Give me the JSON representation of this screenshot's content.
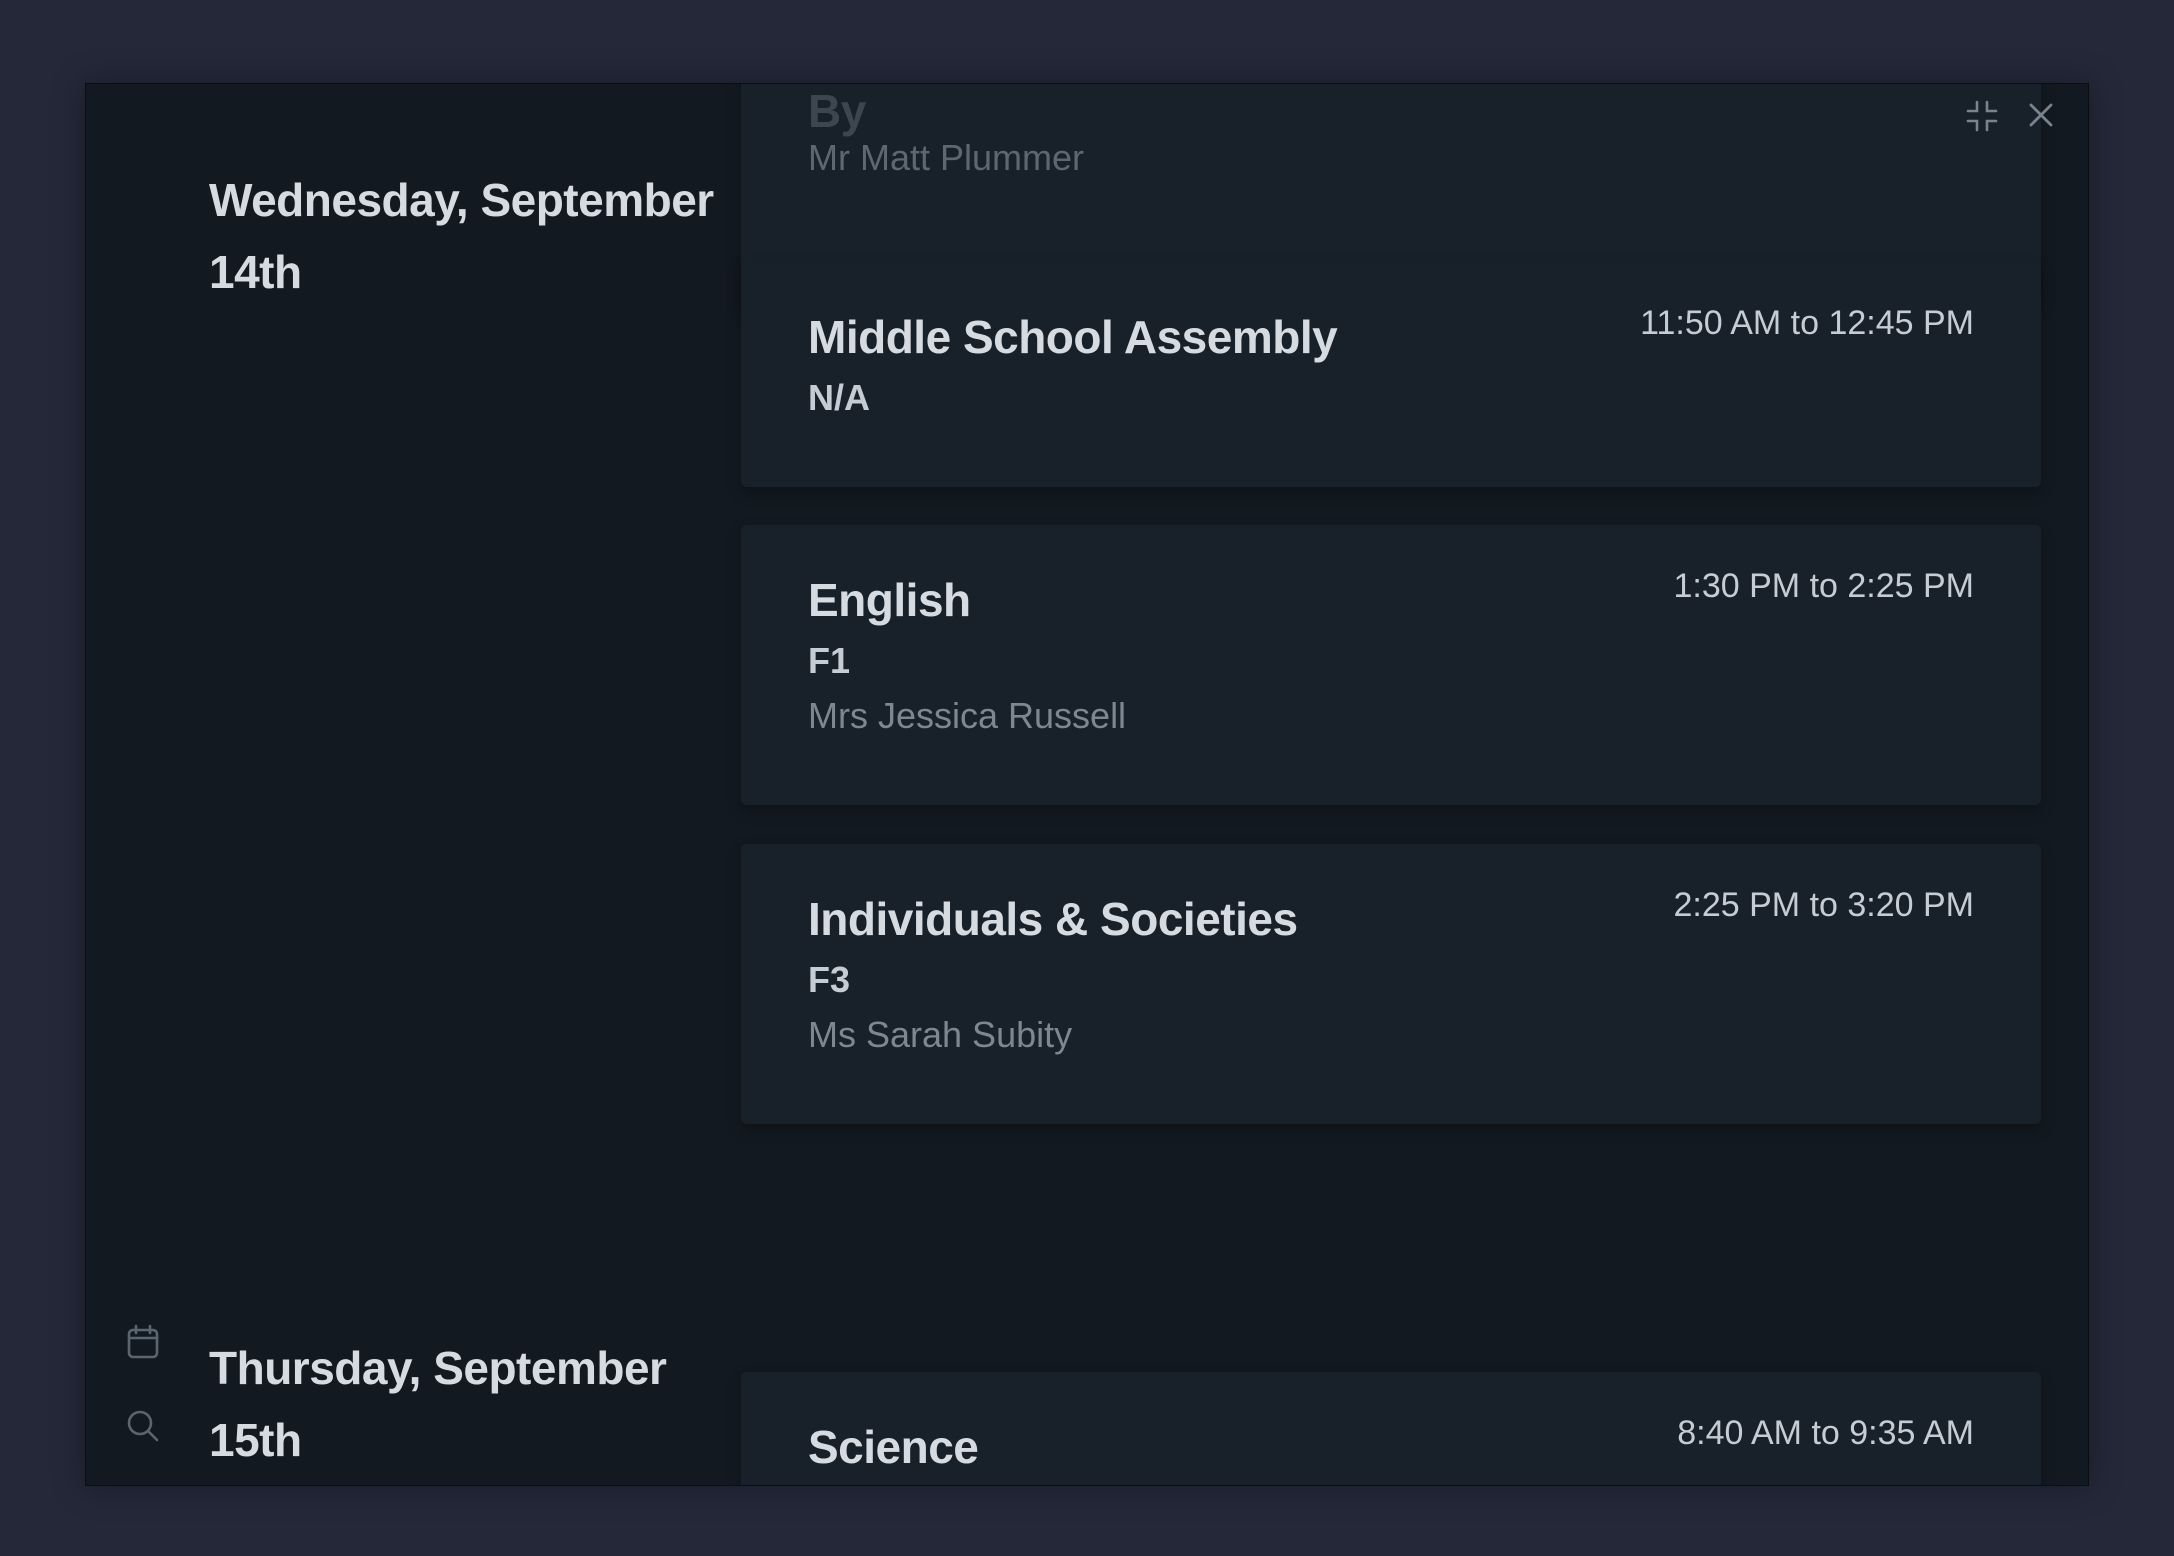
{
  "days": [
    {
      "heading": "Wednesday, September 14th",
      "events": [
        {
          "title": "",
          "room": "",
          "teacher": "Mr Matt Plummer",
          "time": ""
        },
        {
          "title": "Middle School Assembly",
          "room": "N/A",
          "teacher": "",
          "time": "11:50 AM to 12:45 PM"
        },
        {
          "title": "English",
          "room": "F1",
          "teacher": "Mrs Jessica Russell",
          "time": "1:30 PM to 2:25 PM"
        },
        {
          "title": "Individuals & Societies",
          "room": "F3",
          "teacher": "Ms Sarah Subity",
          "time": "2:25 PM to 3:20 PM"
        }
      ]
    },
    {
      "heading": "Thursday, September 15th",
      "events": [
        {
          "title": "Science",
          "room": "",
          "teacher": "",
          "time": "8:40 AM to 9:35 AM"
        }
      ]
    }
  ],
  "controls": {
    "collapse_icon": "collapse-icon",
    "close_icon": "close-icon",
    "calendar_icon": "calendar-icon",
    "search_icon": "search-icon"
  },
  "colors": {
    "backdrop": "#252839",
    "window": "#121920",
    "card": "#18212a",
    "primary_text": "#d6dbe1",
    "muted_text": "#7d8791"
  }
}
